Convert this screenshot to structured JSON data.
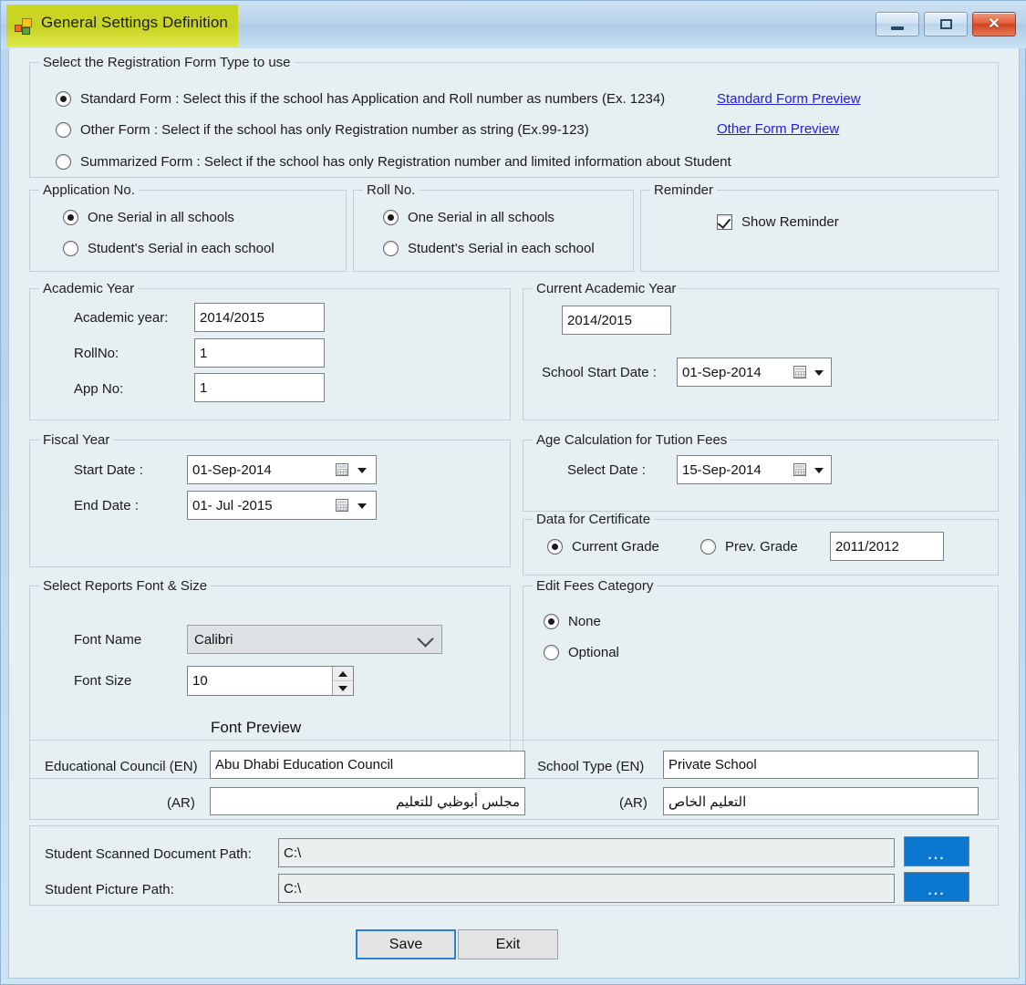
{
  "window": {
    "title": "General Settings Definition",
    "icon": "vb-form-icon",
    "minimize_label": "Minimize",
    "maximize_label": "Maximize",
    "close_label": "Close"
  },
  "registration_group": {
    "title": "Select the Registration Form Type to use",
    "options": [
      {
        "label": "Standard Form : Select this if the school has Application and Roll number as numbers (Ex. 1234)",
        "selected": true
      },
      {
        "label": "Other Form : Select if the school has only Registration number as string (Ex.99-123)",
        "selected": false
      },
      {
        "label": "Summarized Form : Select if the school has only Registration number and limited information about Student",
        "selected": false
      }
    ],
    "links": [
      {
        "label": "Standard Form Preview"
      },
      {
        "label": "Other Form Preview"
      }
    ]
  },
  "application_no": {
    "title": "Application No.",
    "options": [
      {
        "label": "One Serial in all schools",
        "selected": true
      },
      {
        "label": "Student's Serial in each school",
        "selected": false
      }
    ]
  },
  "roll_no": {
    "title": "Roll No.",
    "options": [
      {
        "label": "One Serial in all schools",
        "selected": true
      },
      {
        "label": "Student's Serial in each school",
        "selected": false
      }
    ]
  },
  "reminder": {
    "title": "Reminder",
    "checkbox_label": "Show Reminder",
    "checked": true
  },
  "academic_year": {
    "title": "Academic Year",
    "fields": [
      {
        "label": "Academic year:",
        "value": "2014/2015"
      },
      {
        "label": "RollNo:",
        "value": "1"
      },
      {
        "label": "App No:",
        "value": "1"
      }
    ]
  },
  "current_academic_year": {
    "title": "Current Academic Year",
    "year_value": "2014/2015",
    "start_date_label": "School Start Date :",
    "start_date_value": "01-Sep-2014"
  },
  "fiscal_year": {
    "title": "Fiscal Year",
    "start_label": "Start Date :",
    "start_value": "01-Sep-2014",
    "end_label": "End Date :",
    "end_value": "01- Jul -2015"
  },
  "age_calculation": {
    "title": "Age Calculation for Tution Fees",
    "select_label": "Select Date :",
    "select_value": "15-Sep-2014"
  },
  "data_for_certificate": {
    "title": "Data for Certificate",
    "options": [
      {
        "label": "Current Grade",
        "selected": true
      },
      {
        "label": "Prev. Grade",
        "selected": false
      }
    ],
    "year_value": "2011/2012"
  },
  "reports_font": {
    "title": "Select Reports Font & Size",
    "font_name_label": "Font Name",
    "font_name_value": "Calibri",
    "font_size_label": "Font Size",
    "font_size_value": "10",
    "preview_text": "Font Preview"
  },
  "edit_fees_category": {
    "title": "Edit Fees Category",
    "options": [
      {
        "label": "None",
        "selected": true
      },
      {
        "label": "Optional",
        "selected": false
      }
    ]
  },
  "council_section": {
    "educational_council_en_label": "Educational Council  (EN)",
    "educational_council_en_value": "Abu Dhabi Education Council",
    "educational_council_ar_label": "(AR)",
    "educational_council_ar_value": "مجلس أبوظبي للتعليم",
    "school_type_en_label": "School Type  (EN)",
    "school_type_en_value": "Private School",
    "school_type_ar_label": "(AR)",
    "school_type_ar_value": "التعليم الخاص"
  },
  "paths_section": {
    "scanned_label": "Student Scanned Document Path:",
    "scanned_value": "C:\\",
    "picture_label": "Student Picture Path:",
    "picture_value": "C:\\",
    "browse_label": "..."
  },
  "footer": {
    "save_label": "Save",
    "exit_label": "Exit"
  },
  "colors": {
    "client_background": "#e6eff1",
    "link": "#2121d6",
    "browse_button": "#0b78d0",
    "title_highlight": "#c9d622",
    "focus_border": "#2a7fd4"
  }
}
